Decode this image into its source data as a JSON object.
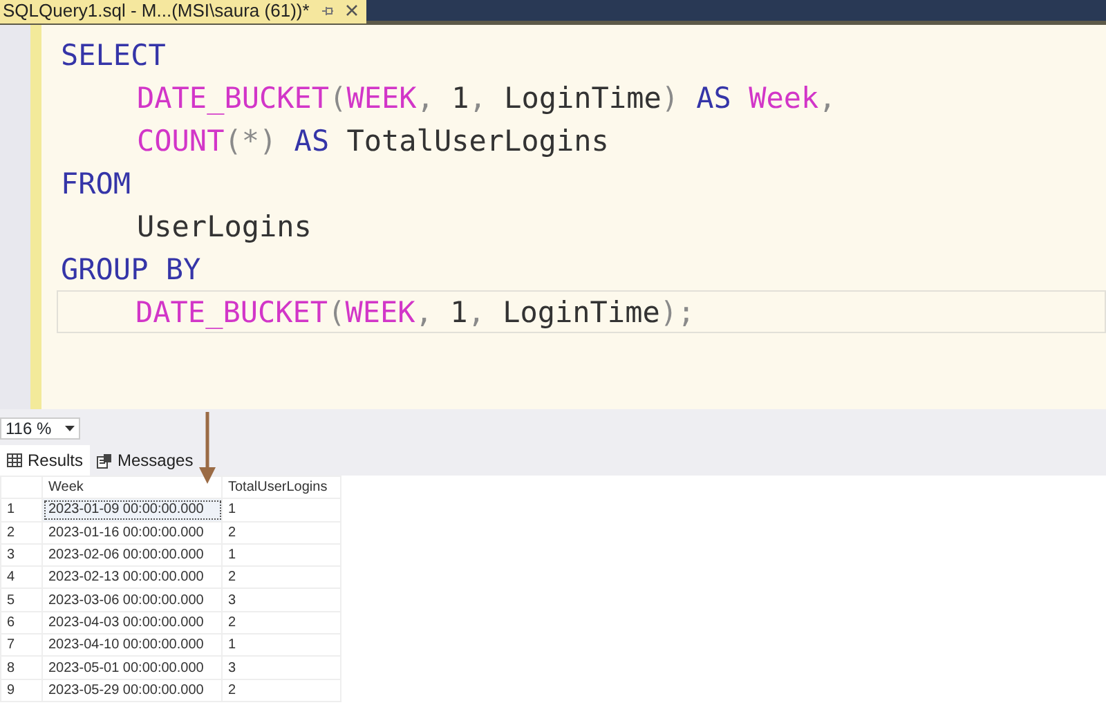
{
  "document_tab": {
    "title": "SQLQuery1.sql - M...(MSI\\saura (61))*"
  },
  "editor": {
    "lines": [
      {
        "indented": false,
        "current": false,
        "tokens": [
          {
            "text": "SELECT",
            "kind": "keyword"
          }
        ]
      },
      {
        "indented": true,
        "current": false,
        "tokens": [
          {
            "text": "DATE_BUCKET",
            "kind": "function"
          },
          {
            "text": "(",
            "kind": "punct"
          },
          {
            "text": "WEEK",
            "kind": "function"
          },
          {
            "text": ", ",
            "kind": "punct"
          },
          {
            "text": "1",
            "kind": "plain"
          },
          {
            "text": ", ",
            "kind": "punct"
          },
          {
            "text": "LoginTime",
            "kind": "plain"
          },
          {
            "text": ") ",
            "kind": "punct"
          },
          {
            "text": "AS ",
            "kind": "keyword"
          },
          {
            "text": "Week",
            "kind": "function"
          },
          {
            "text": ",",
            "kind": "punct"
          }
        ]
      },
      {
        "indented": true,
        "current": false,
        "tokens": [
          {
            "text": "COUNT",
            "kind": "function"
          },
          {
            "text": "(*) ",
            "kind": "punct"
          },
          {
            "text": "AS",
            "kind": "keyword"
          },
          {
            "text": " TotalUserLogins",
            "kind": "plain"
          }
        ]
      },
      {
        "indented": false,
        "current": false,
        "tokens": [
          {
            "text": "FROM",
            "kind": "keyword"
          }
        ]
      },
      {
        "indented": true,
        "current": false,
        "tokens": [
          {
            "text": "UserLogins",
            "kind": "plain"
          }
        ]
      },
      {
        "indented": false,
        "current": false,
        "tokens": [
          {
            "text": "GROUP BY",
            "kind": "keyword"
          }
        ]
      },
      {
        "indented": true,
        "current": true,
        "tokens": [
          {
            "text": "DATE_BUCKET",
            "kind": "function"
          },
          {
            "text": "(",
            "kind": "punct"
          },
          {
            "text": "WEEK",
            "kind": "function"
          },
          {
            "text": ", ",
            "kind": "punct"
          },
          {
            "text": "1",
            "kind": "plain"
          },
          {
            "text": ", ",
            "kind": "punct"
          },
          {
            "text": "LoginTime",
            "kind": "plain"
          },
          {
            "text": ");",
            "kind": "punct"
          }
        ]
      }
    ]
  },
  "zoom": {
    "value": "116 %"
  },
  "result_tabs": [
    {
      "label": "Results",
      "selected": true
    },
    {
      "label": "Messages",
      "selected": false
    }
  ],
  "table": {
    "columns": [
      "Week",
      "TotalUserLogins"
    ],
    "rows": [
      {
        "number": "1",
        "cells": [
          "2023-01-09 00:00:00.000",
          "1"
        ],
        "selected": true
      },
      {
        "number": "2",
        "cells": [
          "2023-01-16 00:00:00.000",
          "2"
        ],
        "selected": false
      },
      {
        "number": "3",
        "cells": [
          "2023-02-06 00:00:00.000",
          "1"
        ],
        "selected": false
      },
      {
        "number": "4",
        "cells": [
          "2023-02-13 00:00:00.000",
          "2"
        ],
        "selected": false
      },
      {
        "number": "5",
        "cells": [
          "2023-03-06 00:00:00.000",
          "3"
        ],
        "selected": false
      },
      {
        "number": "6",
        "cells": [
          "2023-04-03 00:00:00.000",
          "2"
        ],
        "selected": false
      },
      {
        "number": "7",
        "cells": [
          "2023-04-10 00:00:00.000",
          "1"
        ],
        "selected": false
      },
      {
        "number": "8",
        "cells": [
          "2023-05-01 00:00:00.000",
          "3"
        ],
        "selected": false
      },
      {
        "number": "9",
        "cells": [
          "2023-05-29 00:00:00.000",
          "2"
        ],
        "selected": false
      }
    ]
  }
}
